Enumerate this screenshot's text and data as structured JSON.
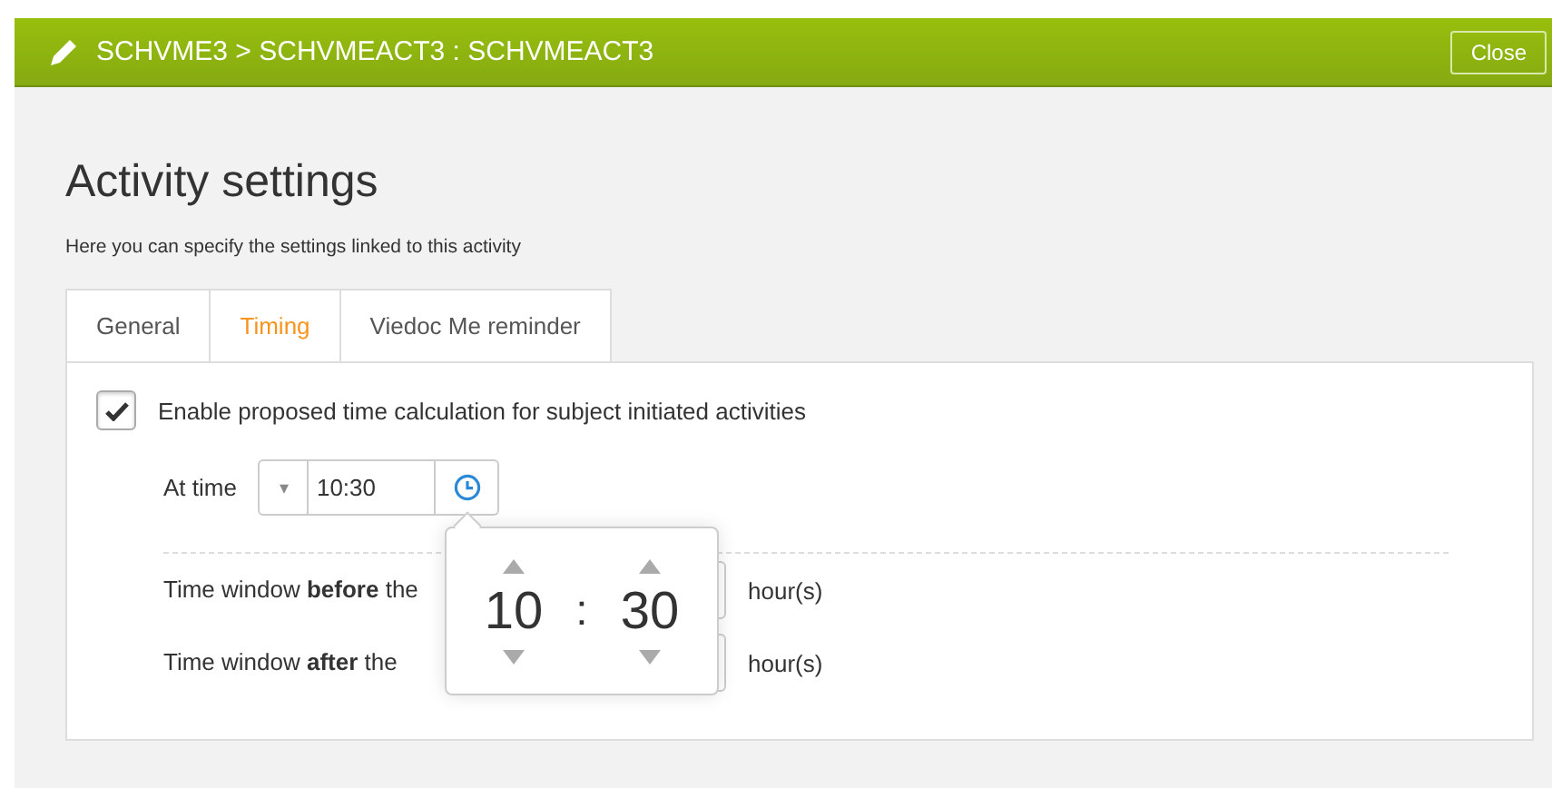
{
  "header": {
    "title": "SCHVME3 > SCHVMEACT3 : SCHVMEACT3",
    "close_button": "Close"
  },
  "page": {
    "title": "Activity settings",
    "description": "Here you can specify the settings linked to this activity"
  },
  "tabs": [
    {
      "label": "General",
      "selected": false
    },
    {
      "label": "Timing",
      "selected": true
    },
    {
      "label": "Viedoc Me reminder",
      "selected": false
    }
  ],
  "timing": {
    "enable_checkbox": {
      "label": "Enable proposed time calculation for subject initiated activities",
      "checked": true
    },
    "at_time": {
      "label": "At time",
      "dropdown_arrow": "▾",
      "value": "10:30"
    },
    "windows": [
      {
        "label": "Time window **before** the",
        "unit": "hour(s)"
      },
      {
        "label": "Time window **after** the",
        "unit": "hour(s)"
      }
    ]
  },
  "time_picker": {
    "hours": "10",
    "separator": ":",
    "minutes": "30"
  }
}
